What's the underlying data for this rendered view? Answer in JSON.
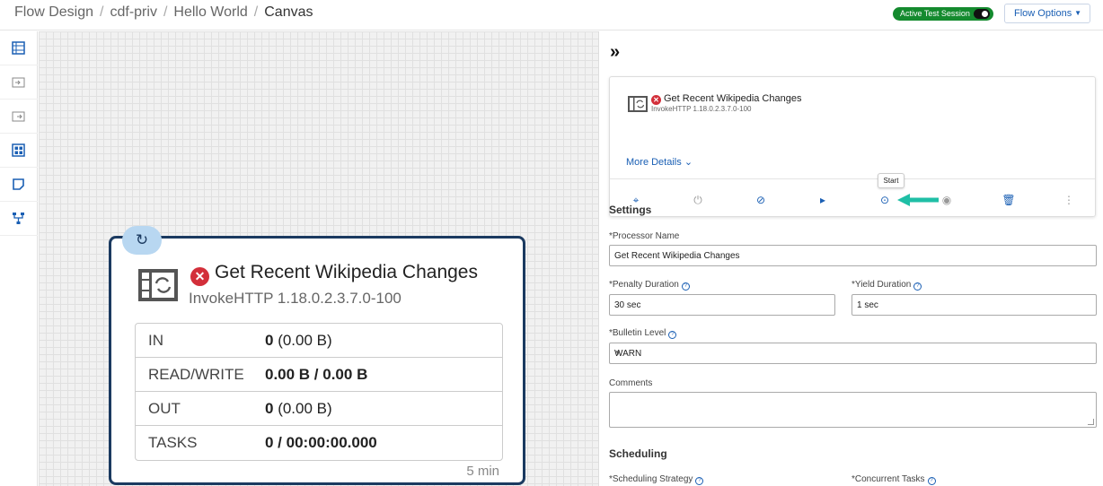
{
  "breadcrumb": {
    "items": [
      "Flow Design",
      "cdf-priv",
      "Hello World"
    ],
    "current": "Canvas"
  },
  "header": {
    "session_label": "Active Test Session",
    "flow_options_label": "Flow Options"
  },
  "rail": {
    "icons": [
      "processor-icon",
      "input-port-icon",
      "output-port-icon",
      "process-group-icon",
      "label-icon",
      "funnel-icon"
    ]
  },
  "processor": {
    "name": "Get Recent Wikipedia Changes",
    "type": "InvokeHTTP 1.18.0.2.3.7.0-100",
    "stats": [
      {
        "label": "IN",
        "value_bold": "0",
        "value_rest": " (0.00 B)"
      },
      {
        "label": "READ/WRITE",
        "value_bold": "0.00 B / 0.00 B",
        "value_rest": ""
      },
      {
        "label": "OUT",
        "value_bold": "0",
        "value_rest": " (0.00 B)"
      },
      {
        "label": "TASKS",
        "value_bold": "0 / 00:00:00.000",
        "value_rest": ""
      }
    ],
    "footer": "5 min"
  },
  "panel": {
    "collapse_glyph": "»",
    "summary": {
      "name": "Get Recent Wikipedia Changes",
      "type": "InvokeHTTP 1.18.0.2.3.7.0-100",
      "more_details": "More Details",
      "tooltip": "Start"
    },
    "settings": {
      "title": "Settings",
      "processor_name_label": "*Processor Name",
      "processor_name_value": "Get Recent Wikipedia Changes",
      "penalty_label": "*Penalty Duration",
      "penalty_value": "30 sec",
      "yield_label": "*Yield Duration",
      "yield_value": "1 sec",
      "bulletin_label": "*Bulletin Level",
      "bulletin_value": "WARN",
      "comments_label": "Comments"
    },
    "scheduling": {
      "title": "Scheduling",
      "strategy_label": "*Scheduling Strategy",
      "concurrent_label": "*Concurrent Tasks"
    }
  },
  "colors": {
    "accent": "#1a5fb4",
    "error": "#d32f3a",
    "session_green": "#148a2e",
    "card_border": "#1b3a60",
    "arrow": "#1fbfa6"
  }
}
